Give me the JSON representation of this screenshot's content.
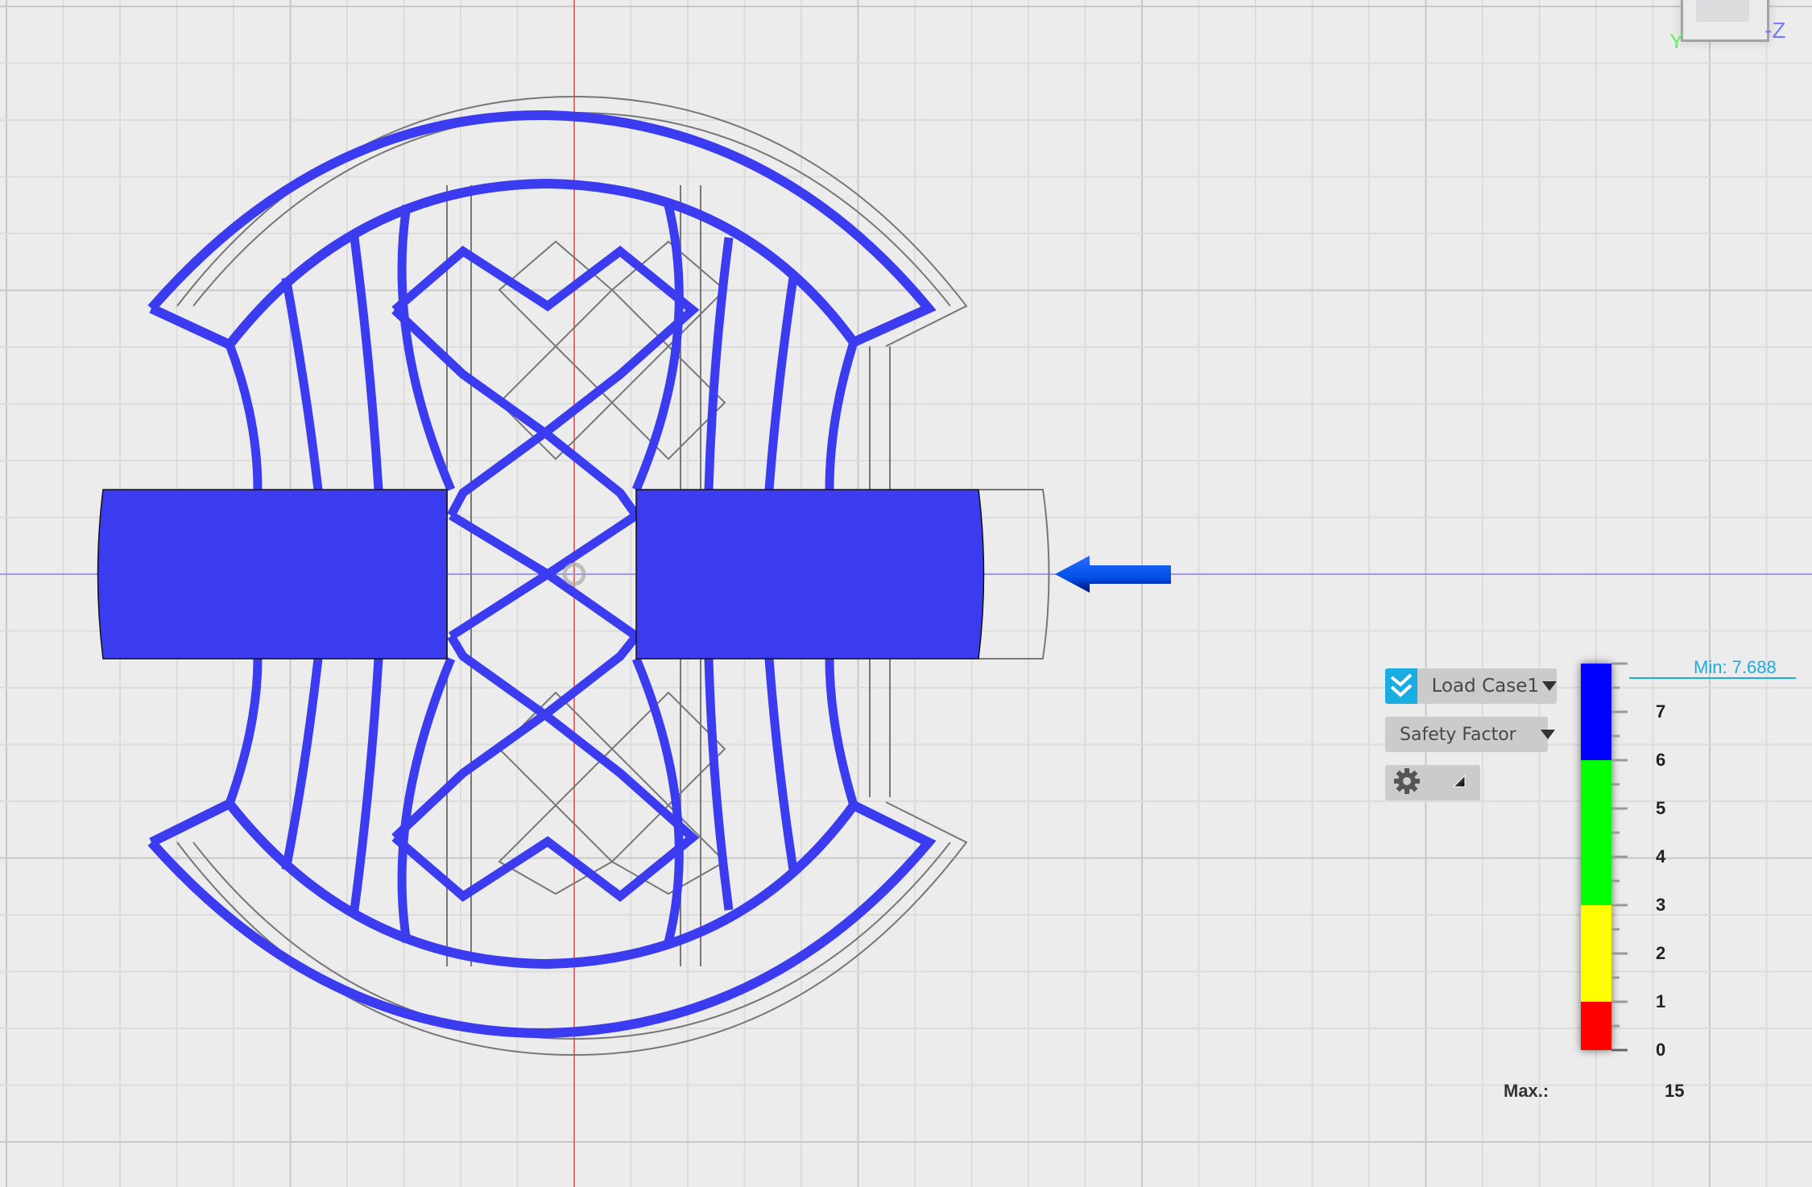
{
  "app": {
    "view": "simulation-results-viewport"
  },
  "viewport": {
    "background_color": "#ececec",
    "grid_color": "#dcdcdc",
    "grid_major_color": "#c8c8c8",
    "x_axis_color": "#e86a6a",
    "z_axis_color": "#8a8ae8",
    "model_fill_color": "#3b3bf0",
    "load_arrow_color": "#0050e6",
    "load_arrow_direction": "left"
  },
  "view_cube": {
    "axis_labels": {
      "y": "Y",
      "z": "-Z"
    },
    "axis_colors": {
      "y": "#66ee66",
      "z": "#7b7bf0"
    }
  },
  "results_panel": {
    "load_case": {
      "label": "Load Case1",
      "icon": "double-check-icon",
      "accent": "#19ade1"
    },
    "result_type": {
      "label": "Safety Factor"
    },
    "settings": {
      "icon": "gear-icon",
      "expand_icon": "expand-corner-icon"
    }
  },
  "legend": {
    "title": "Safety Factor",
    "min_label": "Min: 7.688",
    "min_value": 7.688,
    "max_label": "Max.:",
    "max_value": "15",
    "range": [
      0,
      8
    ],
    "tick_labels": [
      "7",
      "6",
      "5",
      "4",
      "3",
      "2",
      "1",
      "0"
    ],
    "bands": [
      {
        "from": 6,
        "to": 8,
        "color": "#0000ff"
      },
      {
        "from": 3,
        "to": 6,
        "color": "#00ff00"
      },
      {
        "from": 1,
        "to": 3,
        "color": "#ffff00"
      },
      {
        "from": 0,
        "to": 1,
        "color": "#ff0000"
      }
    ]
  }
}
